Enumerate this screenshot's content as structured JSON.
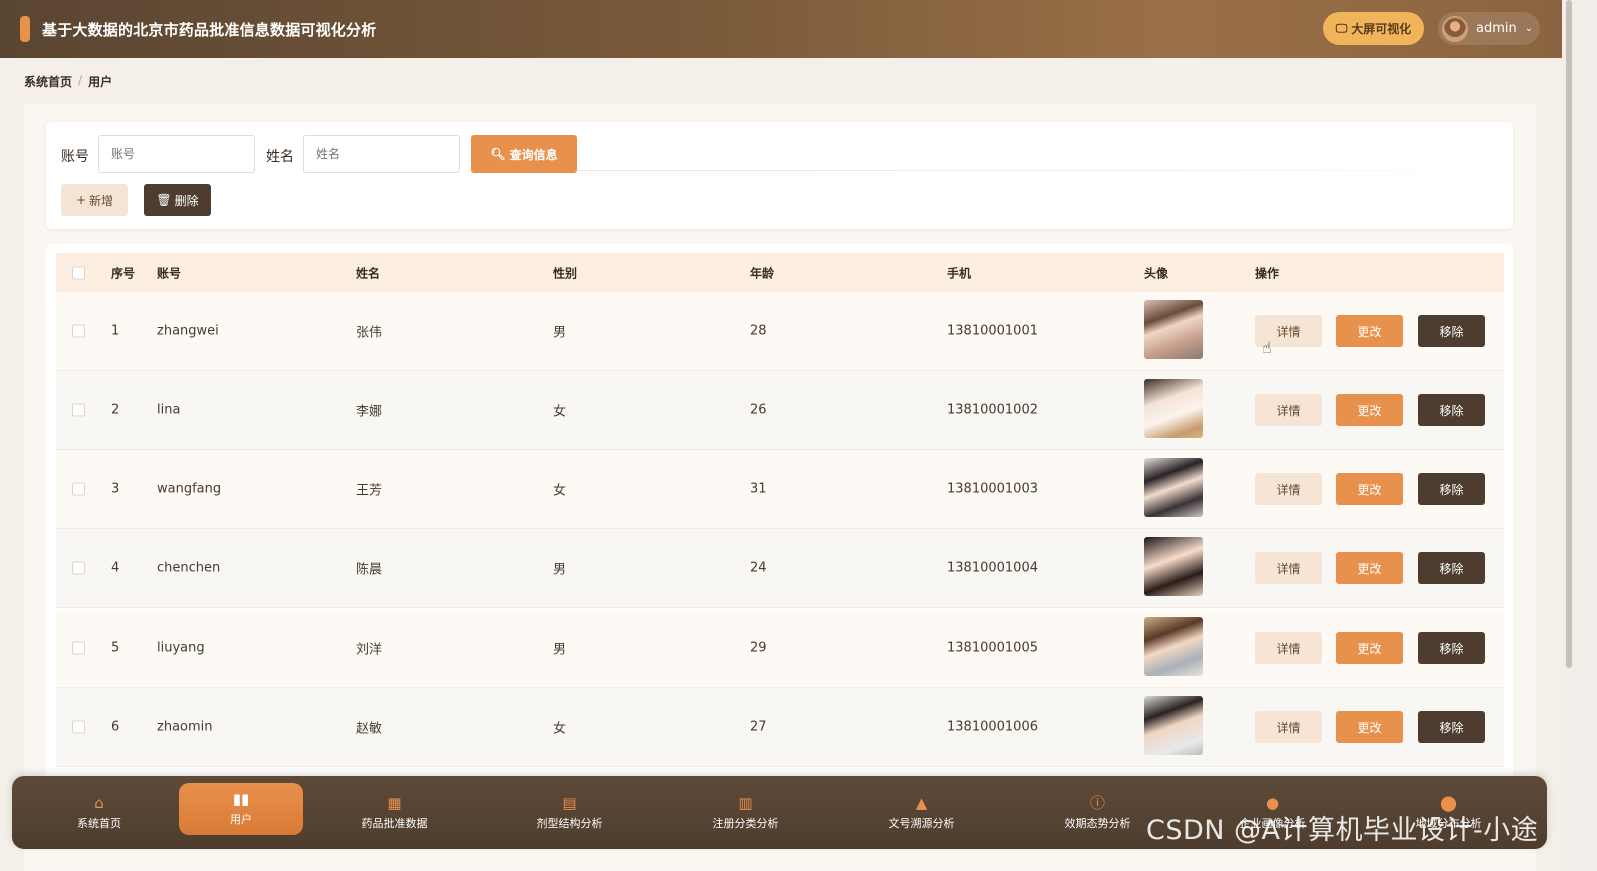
{
  "header": {
    "title": "基于大数据的北京市药品批准信息数据可视化分析",
    "bigscreen_label": "大屏可视化",
    "username": "admin"
  },
  "breadcrumb": {
    "home": "系统首页",
    "separator": "/",
    "current": "用户"
  },
  "filter": {
    "account_label": "账号",
    "account_placeholder": "账号",
    "name_label": "姓名",
    "name_placeholder": "姓名",
    "query_label": "查询信息",
    "add_label": "新增",
    "delete_label": "删除"
  },
  "table": {
    "columns": [
      "序号",
      "账号",
      "姓名",
      "性别",
      "年龄",
      "手机",
      "头像",
      "操作"
    ],
    "rows": [
      {
        "index": "1",
        "account": "zhangwei",
        "name": "张伟",
        "gender": "男",
        "age": "28",
        "phone": "13810001001"
      },
      {
        "index": "2",
        "account": "lina",
        "name": "李娜",
        "gender": "女",
        "age": "26",
        "phone": "13810001002"
      },
      {
        "index": "3",
        "account": "wangfang",
        "name": "王芳",
        "gender": "女",
        "age": "31",
        "phone": "13810001003"
      },
      {
        "index": "4",
        "account": "chenchen",
        "name": "陈晨",
        "gender": "男",
        "age": "24",
        "phone": "13810001004"
      },
      {
        "index": "5",
        "account": "liuyang",
        "name": "刘洋",
        "gender": "男",
        "age": "29",
        "phone": "13810001005"
      },
      {
        "index": "6",
        "account": "zhaomin",
        "name": "赵敏",
        "gender": "女",
        "age": "27",
        "phone": "13810001006"
      }
    ],
    "actions": {
      "detail": "详情",
      "edit": "更改",
      "remove": "移除"
    }
  },
  "bottom_nav": [
    {
      "label": "系统首页",
      "icon": "home-icon"
    },
    {
      "label": "用户",
      "icon": "bar-chart-icon",
      "active": true
    },
    {
      "label": "药品批准数据",
      "icon": "grid-icon"
    },
    {
      "label": "剂型结构分析",
      "icon": "clipboard-icon"
    },
    {
      "label": "注册分类分析",
      "icon": "calendar-icon"
    },
    {
      "label": "文号溯源分析",
      "icon": "trend-icon"
    },
    {
      "label": "效期态势分析",
      "icon": "alert-icon"
    },
    {
      "label": "企业画像分析",
      "icon": "person-icon"
    },
    {
      "label": "地域分布分析",
      "icon": "pin-icon"
    }
  ],
  "watermark": "CSDN @A计算机毕业设计-小途",
  "colors": {
    "accent": "#e8914c",
    "dark": "#4e3d2e",
    "light": "#f6e4d4",
    "header_bg": "#7a5a3a"
  }
}
